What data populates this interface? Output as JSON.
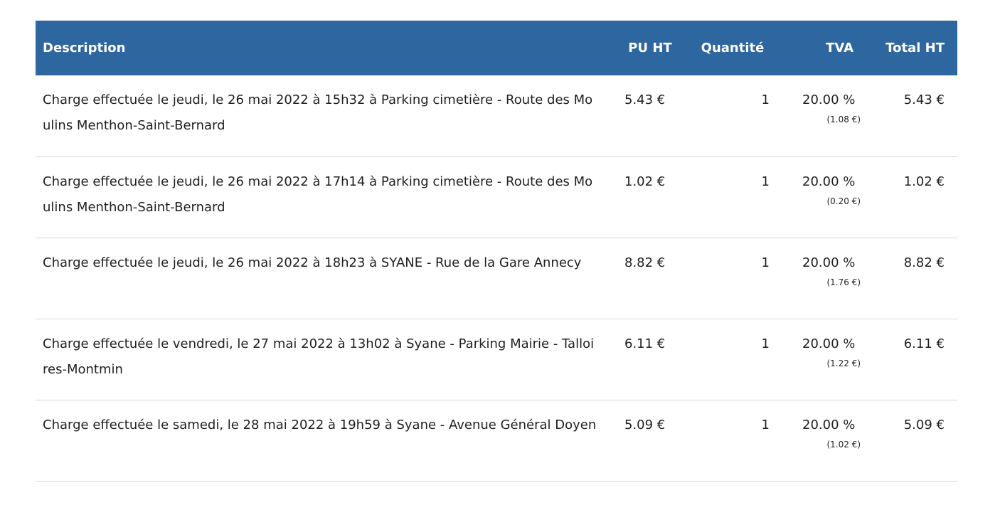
{
  "colors": {
    "header_bg": "#2e67a0",
    "header_text": "#ffffff",
    "row_divider": "#d6d6d6"
  },
  "table": {
    "headers": {
      "description": "Description",
      "pu_ht": "PU HT",
      "quantite": "Quantité",
      "tva": "TVA",
      "total_ht": "Total HT"
    },
    "rows": [
      {
        "description": "Charge effectuée le jeudi, le 26 mai 2022 à 15h32 à Parking cimetière - Route des Moulins Menthon-Saint-Bernard",
        "pu_ht": "5.43 €",
        "quantite": "1",
        "tva_rate": "20.00 %",
        "tva_amount": "(1.08 €)",
        "total_ht": "5.43 €"
      },
      {
        "description": "Charge effectuée le jeudi, le 26 mai 2022 à 17h14 à Parking cimetière - Route des Moulins Menthon-Saint-Bernard",
        "pu_ht": "1.02 €",
        "quantite": "1",
        "tva_rate": "20.00 %",
        "tva_amount": "(0.20 €)",
        "total_ht": "1.02 €"
      },
      {
        "description": "Charge effectuée le jeudi, le 26 mai 2022 à 18h23 à SYANE - Rue de la Gare  Annecy",
        "pu_ht": "8.82 €",
        "quantite": "1",
        "tva_rate": "20.00 %",
        "tva_amount": "(1.76 €)",
        "total_ht": "8.82 €"
      },
      {
        "description": "Charge effectuée le vendredi, le 27 mai 2022 à 13h02 à Syane - Parking Mairie - Talloires-Montmin",
        "pu_ht": "6.11 €",
        "quantite": "1",
        "tva_rate": "20.00 %",
        "tva_amount": "(1.22 €)",
        "total_ht": "6.11 €"
      },
      {
        "description": "Charge effectuée le samedi, le 28 mai 2022 à 19h59 à Syane - Avenue Général Doyen",
        "pu_ht": "5.09 €",
        "quantite": "1",
        "tva_rate": "20.00 %",
        "tva_amount": "(1.02 €)",
        "total_ht": "5.09 €"
      }
    ]
  }
}
